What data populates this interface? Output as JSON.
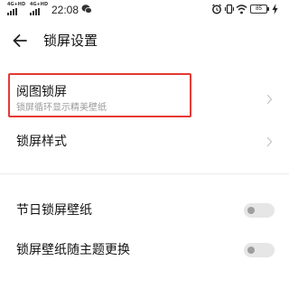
{
  "status_bar": {
    "network_1": "4G+HD",
    "network_2": "4G+HD",
    "time": "22:08",
    "battery": "85"
  },
  "header": {
    "title": "锁屏设置"
  },
  "items": [
    {
      "title": "阅图锁屏",
      "subtitle": "锁屏循环显示精美壁纸"
    },
    {
      "title": "锁屏样式"
    },
    {
      "title": "节日锁屏壁纸",
      "toggle_on": false
    },
    {
      "title": "锁屏壁纸随主题更换",
      "toggle_on": false
    }
  ],
  "icons": {
    "back": "arrow-left-icon",
    "chevron": "chevron-right-icon",
    "alarm": "alarm-icon",
    "mute": "vibrate-icon",
    "wifi": "wifi-icon",
    "charging": "lightning-icon"
  },
  "colors": {
    "highlight": "#e53935",
    "toggle_track": "#e6e6e6",
    "toggle_knob": "#9e9e9e",
    "subtitle": "#9a9a9a"
  }
}
